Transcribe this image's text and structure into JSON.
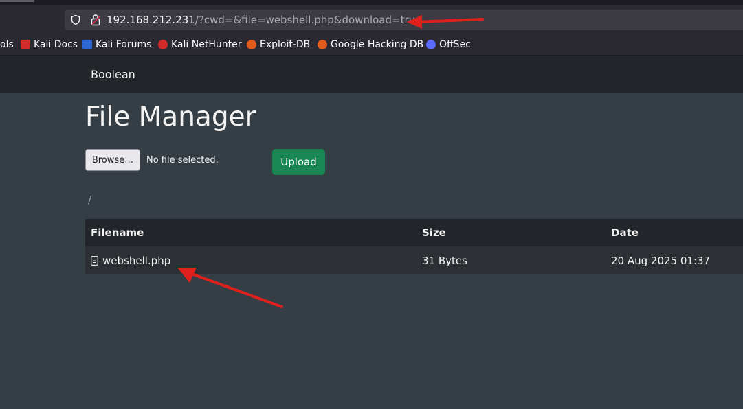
{
  "browser": {
    "url_host": "192.168.212.231",
    "url_path": "/?cwd=&file=webshell.php&download=true",
    "shield_icon": "shield-icon",
    "lock_icon": "lock-icon"
  },
  "bookmarks": [
    {
      "label": "ols",
      "icon": "folder-icon"
    },
    {
      "label": "Kali Docs",
      "icon": "kali-docs-icon",
      "color": "#d22b2b"
    },
    {
      "label": "Kali Forums",
      "icon": "kali-forums-icon",
      "color": "#2b66d2"
    },
    {
      "label": "Kali NetHunter",
      "icon": "kali-nethunter-icon",
      "color": "#d22b2b"
    },
    {
      "label": "Exploit-DB",
      "icon": "exploit-db-icon",
      "color": "#e05a1c"
    },
    {
      "label": "Google Hacking DB",
      "icon": "ghdb-icon",
      "color": "#e05a1c"
    },
    {
      "label": "OffSec",
      "icon": "offsec-icon",
      "color": "#5b6bff"
    }
  ],
  "app": {
    "brand": "Boolean",
    "title": "File Manager",
    "browse_label": "Browse…",
    "no_file_text": "No file selected.",
    "upload_label": "Upload",
    "breadcrumb": "/"
  },
  "table": {
    "headers": [
      "Filename",
      "Size",
      "Date"
    ],
    "rows": [
      {
        "filename": "webshell.php",
        "size": "31 Bytes",
        "date": "20 Aug 2025 01:37",
        "icon": "file-icon"
      }
    ]
  },
  "colors": {
    "accent_green": "#198754",
    "annotation_arrow": "#e0201c"
  }
}
